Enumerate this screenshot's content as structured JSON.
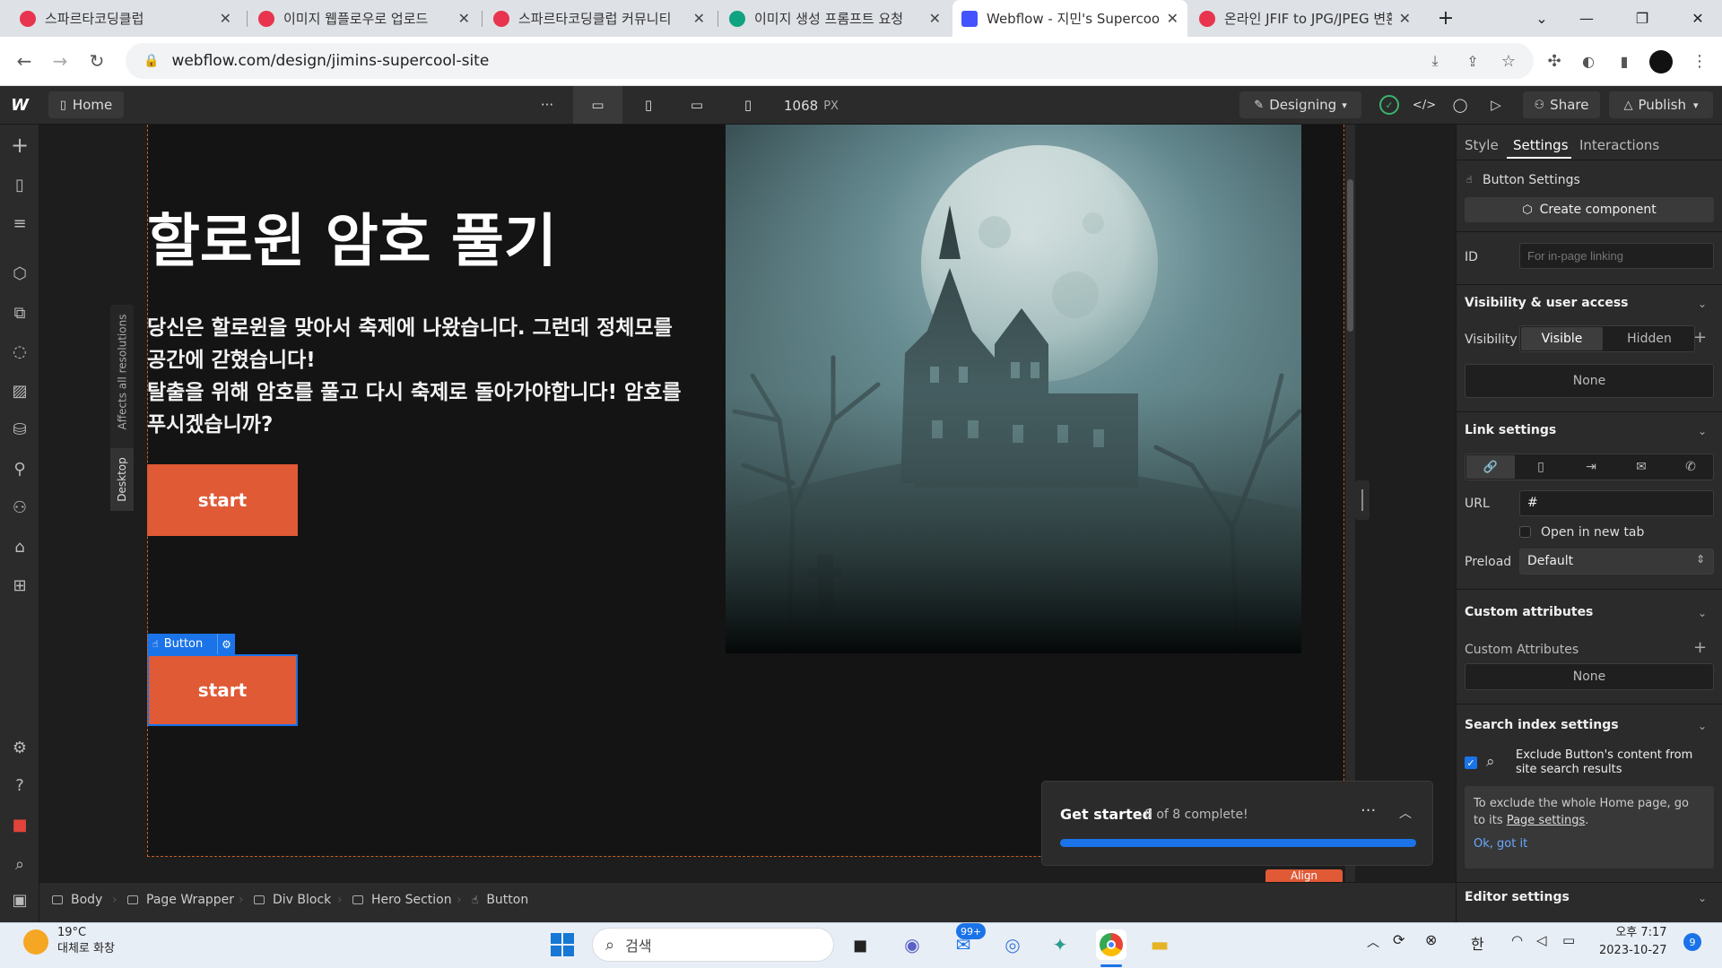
{
  "browser": {
    "tabs": [
      {
        "title": "스파르타코딩클럽",
        "favicon": "sparta-icon",
        "color": "#e8344e"
      },
      {
        "title": "이미지 웹플로우로 업로드",
        "favicon": "sparta-icon",
        "color": "#e8344e"
      },
      {
        "title": "스파르타코딩클럽 커뮤니티",
        "favicon": "sparta-icon",
        "color": "#e8344e"
      },
      {
        "title": "이미지 생성 프롬프트 요청",
        "favicon": "chatgpt-icon",
        "color": "#10a37f"
      },
      {
        "title": "Webflow - 지민's Supercool",
        "favicon": "webflow-icon",
        "color": "#4353ff"
      },
      {
        "title": "온라인 JFIF to JPG/JPEG 변환",
        "favicon": "converter-icon",
        "color": "#e8344e"
      }
    ],
    "url": "webflow.com/design/jimins-supercool-site"
  },
  "toolbar": {
    "page_label": "Home",
    "width_value": "1068",
    "width_unit": "PX",
    "mode_label": "Designing",
    "share_label": "Share",
    "publish_label": "Publish"
  },
  "canvas": {
    "side_labels": {
      "resolution": "Affects all resolutions",
      "breakpoint": "Desktop"
    },
    "hero": {
      "title": "할로윈 암호 풀기",
      "description_line1": "당신은 할로윈을 맞아서 축제에 나왔습니다. 그런데 정체모를",
      "description_line2": "공간에 갇혔습니다!",
      "description_line3": "탈출을 위해 암호를 풀고 다시 축제로 돌아가야합니다! 암호를",
      "description_line4": "푸시겠습니까?",
      "button_label": "start",
      "selected_button_label": "start",
      "selected_tag": "Button"
    },
    "accent_color": "#e05a36",
    "selection_color": "#1a73e8"
  },
  "get_started": {
    "title": "Get started",
    "progress_text": "8 of 8 complete!",
    "progress": 1.0,
    "align_label": "Align"
  },
  "right_panel": {
    "tabs": [
      "Style",
      "Settings",
      "Interactions"
    ],
    "active_tab": "Settings",
    "button_settings_label": "Button Settings",
    "create_component_label": "Create component",
    "id_label": "ID",
    "id_placeholder": "For in-page linking",
    "visibility_section": "Visibility & user access",
    "visibility_label": "Visibility",
    "visibility_options": [
      "Visible",
      "Hidden"
    ],
    "visibility_none": "None",
    "link_section": "Link settings",
    "url_label": "URL",
    "url_value": "#",
    "new_tab_label": "Open in new tab",
    "preload_label": "Preload",
    "preload_value": "Default",
    "custom_attr_section": "Custom attributes",
    "custom_attr_label": "Custom Attributes",
    "custom_attr_none": "None",
    "search_section": "Search index settings",
    "exclude_label_line1": "Exclude Button's content from",
    "exclude_label_line2": "site search results",
    "info_text_line1": "To exclude the whole Home page, go",
    "info_text_prefix": "to its ",
    "info_link": "Page settings",
    "info_suffix": ".",
    "ok_label": "Ok, got it",
    "editor_section": "Editor settings"
  },
  "breadcrumb": [
    "Body",
    "Page Wrapper",
    "Div Block",
    "Hero Section",
    "Button"
  ],
  "taskbar": {
    "weather_temp": "19°C",
    "weather_desc": "대체로 화창",
    "search_placeholder": "검색",
    "mail_badge": "99+",
    "ime": "한",
    "time": "오후 7:17",
    "date": "2023-10-27",
    "notif_count": "9"
  }
}
